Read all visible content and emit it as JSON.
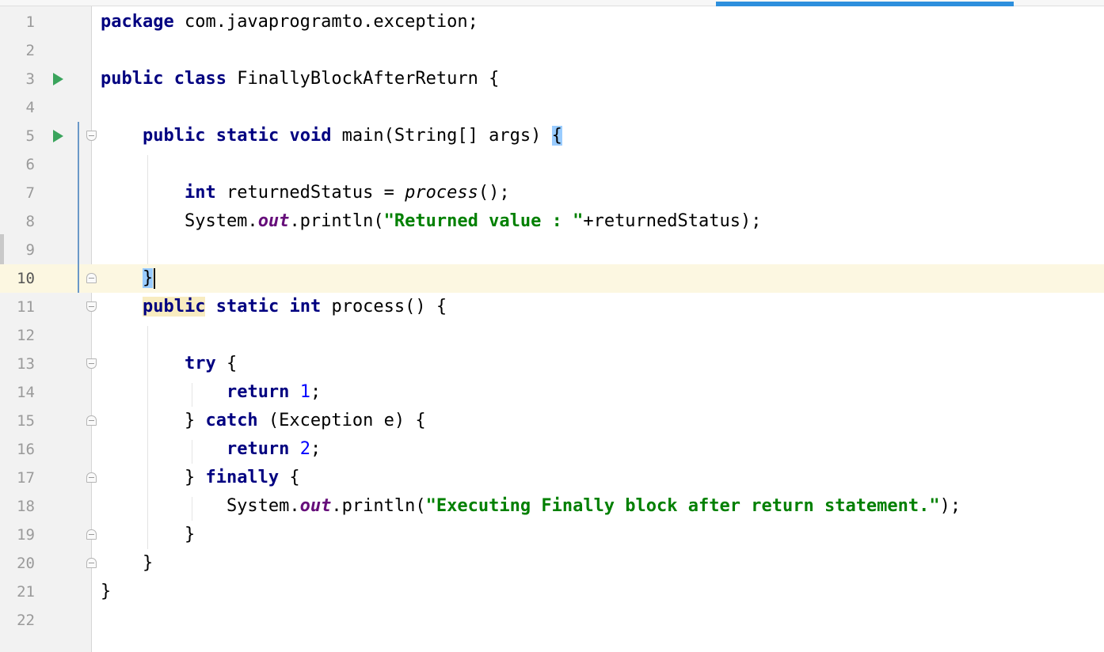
{
  "editor": {
    "current_line": 10,
    "lines": [
      {
        "n": "1",
        "tokens": [
          {
            "t": "package",
            "c": "kw"
          },
          {
            "t": " com.javaprogramto.exception;"
          }
        ]
      },
      {
        "n": "2",
        "tokens": []
      },
      {
        "n": "3",
        "run": true,
        "tokens": [
          {
            "t": "public",
            "c": "kw"
          },
          {
            "t": " "
          },
          {
            "t": "class",
            "c": "kw"
          },
          {
            "t": " FinallyBlockAfterReturn {"
          }
        ]
      },
      {
        "n": "4",
        "tokens": []
      },
      {
        "n": "5",
        "run": true,
        "fold": "start",
        "changed": true,
        "tokens": [
          {
            "t": "    "
          },
          {
            "t": "public",
            "c": "kw"
          },
          {
            "t": " "
          },
          {
            "t": "static",
            "c": "kw"
          },
          {
            "t": " "
          },
          {
            "t": "void",
            "c": "kw"
          },
          {
            "t": " main(String[] args) "
          },
          {
            "t": "{",
            "c": "brace-hl"
          }
        ]
      },
      {
        "n": "6",
        "changed": true,
        "tokens": []
      },
      {
        "n": "7",
        "changed": true,
        "tokens": [
          {
            "t": "        "
          },
          {
            "t": "int",
            "c": "kw"
          },
          {
            "t": " returnedStatus = "
          },
          {
            "t": "process",
            "c": "italic"
          },
          {
            "t": "();"
          }
        ]
      },
      {
        "n": "8",
        "changed": true,
        "tokens": [
          {
            "t": "        System."
          },
          {
            "t": "out",
            "c": "field"
          },
          {
            "t": ".println("
          },
          {
            "t": "\"Returned value : \"",
            "c": "str"
          },
          {
            "t": "+returnedStatus);"
          }
        ]
      },
      {
        "n": "9",
        "changed": true,
        "tokens": []
      },
      {
        "n": "10",
        "fold": "end",
        "changed": true,
        "caret": true,
        "tokens": [
          {
            "t": "    "
          },
          {
            "t": "}",
            "c": "brace-hl"
          }
        ]
      },
      {
        "n": "11",
        "fold": "start",
        "tokens": [
          {
            "t": "    "
          },
          {
            "t": "public",
            "c": "kw kw-hl"
          },
          {
            "t": " "
          },
          {
            "t": "static",
            "c": "kw"
          },
          {
            "t": " "
          },
          {
            "t": "int",
            "c": "kw"
          },
          {
            "t": " process() {"
          }
        ]
      },
      {
        "n": "12",
        "tokens": []
      },
      {
        "n": "13",
        "fold": "start",
        "tokens": [
          {
            "t": "        "
          },
          {
            "t": "try",
            "c": "kw"
          },
          {
            "t": " {"
          }
        ]
      },
      {
        "n": "14",
        "tokens": [
          {
            "t": "            "
          },
          {
            "t": "return",
            "c": "kw"
          },
          {
            "t": " "
          },
          {
            "t": "1",
            "c": "num"
          },
          {
            "t": ";"
          }
        ]
      },
      {
        "n": "15",
        "fold": "end",
        "tokens": [
          {
            "t": "        } "
          },
          {
            "t": "catch",
            "c": "kw"
          },
          {
            "t": " (Exception e) {"
          }
        ]
      },
      {
        "n": "16",
        "tokens": [
          {
            "t": "            "
          },
          {
            "t": "return",
            "c": "kw"
          },
          {
            "t": " "
          },
          {
            "t": "2",
            "c": "num"
          },
          {
            "t": ";"
          }
        ]
      },
      {
        "n": "17",
        "fold": "end",
        "tokens": [
          {
            "t": "        } "
          },
          {
            "t": "finally",
            "c": "kw"
          },
          {
            "t": " {"
          }
        ]
      },
      {
        "n": "18",
        "tokens": [
          {
            "t": "            System."
          },
          {
            "t": "out",
            "c": "field"
          },
          {
            "t": ".println("
          },
          {
            "t": "\"Executing Finally block after return statement.\"",
            "c": "str"
          },
          {
            "t": ");"
          }
        ]
      },
      {
        "n": "19",
        "fold": "end",
        "tokens": [
          {
            "t": "        }"
          }
        ]
      },
      {
        "n": "20",
        "fold": "end",
        "tokens": [
          {
            "t": "    }"
          }
        ]
      },
      {
        "n": "21",
        "tokens": [
          {
            "t": "}"
          }
        ]
      },
      {
        "n": "22",
        "tokens": []
      }
    ]
  },
  "colors": {
    "keyword": "#000080",
    "string": "#008000",
    "number": "#0000ff",
    "field": "#660e7a",
    "current_line_bg": "#fcf7e1",
    "brace_match": "#99ccff",
    "run_icon": "#3aa45c",
    "accent": "#2d8fdd"
  },
  "icons": {
    "run": "run-gutter-icon",
    "fold_start": "fold-start-icon",
    "fold_end": "fold-end-icon"
  }
}
